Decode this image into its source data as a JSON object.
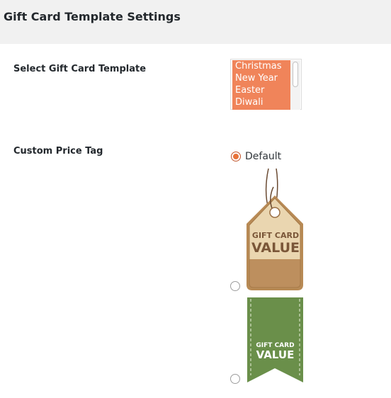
{
  "header": {
    "title": "Gift Card Template Settings"
  },
  "template_setting": {
    "label": "Select Gift Card Template",
    "options": [
      "Christmas",
      "New Year",
      "Easter",
      "Diwali"
    ]
  },
  "price_tag_setting": {
    "label": "Custom Price Tag",
    "default_option_label": "Default",
    "selected": "Default",
    "tag_brown": {
      "line1": "GIFT CARD",
      "line2": "VALUE"
    },
    "tag_green": {
      "line1": "GIFT CARD",
      "line2": "VALUE"
    }
  },
  "colors": {
    "listbox_selected": "#f0845a",
    "radio_accent": "#e8743b",
    "header_bg": "#f1f1f1"
  }
}
